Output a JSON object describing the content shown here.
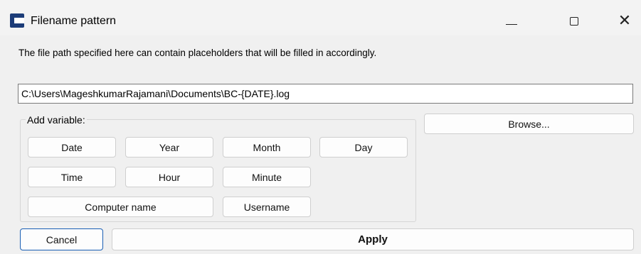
{
  "window": {
    "title": "Filename pattern"
  },
  "description": "The file path specified here can contain placeholders that will be filled in accordingly.",
  "path_input": {
    "value": "C:\\Users\\MageshkumarRajamani\\Documents\\BC-{DATE}.log"
  },
  "variables": {
    "group_label": "Add variable:",
    "buttons": {
      "date": "Date",
      "year": "Year",
      "month": "Month",
      "day": "Day",
      "time": "Time",
      "hour": "Hour",
      "minute": "Minute",
      "computer_name": "Computer name",
      "username": "Username"
    }
  },
  "actions": {
    "browse": "Browse...",
    "cancel": "Cancel",
    "apply": "Apply"
  },
  "icons": {
    "app": "app-logo-icon",
    "minimize": "minimize-icon",
    "maximize": "maximize-icon",
    "close": "close-icon"
  },
  "colors": {
    "app_icon": "#1c3c78",
    "focus_border": "#1a5fb4"
  }
}
